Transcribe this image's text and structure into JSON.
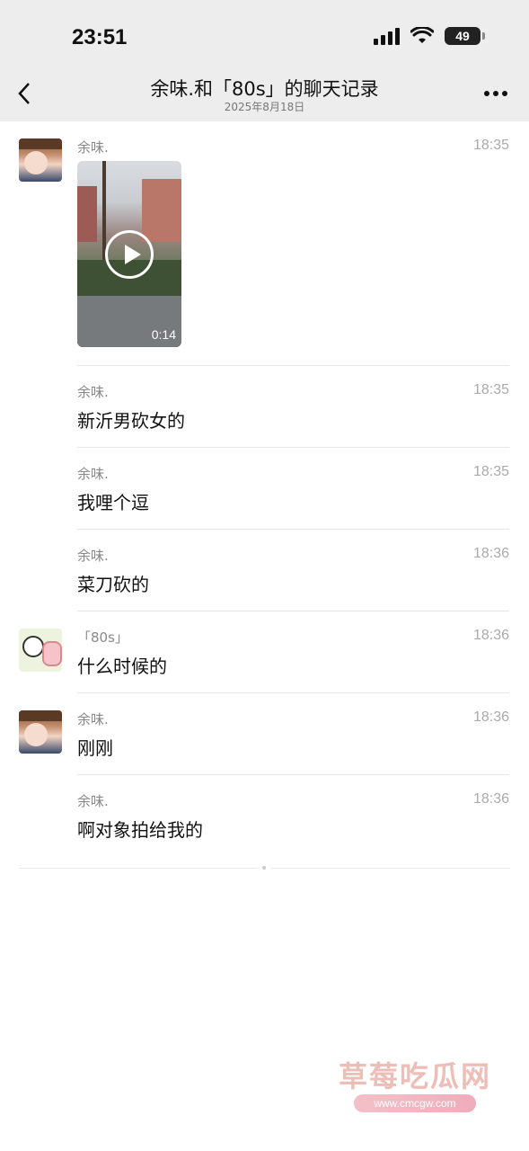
{
  "status_bar": {
    "time": "23:51",
    "battery": "49"
  },
  "nav": {
    "back_icon": "chevron-left-icon",
    "title": "余味.和「80s」的聊天记录",
    "subtitle": "2025年8月18日",
    "more_icon": "more-dots-icon"
  },
  "messages": [
    {
      "sender": "余味.",
      "time": "18:35",
      "type": "video",
      "duration": "0:14"
    },
    {
      "sender": "余味.",
      "time": "18:35",
      "text": "新沂男砍女的"
    },
    {
      "sender": "余味.",
      "time": "18:35",
      "text": "我哩个逗"
    },
    {
      "sender": "余味.",
      "time": "18:36",
      "text": "菜刀砍的"
    },
    {
      "sender": "「80s」",
      "time": "18:36",
      "text": "什么时候的"
    },
    {
      "sender": "余味.",
      "time": "18:36",
      "text": "刚刚"
    },
    {
      "sender": "余味.",
      "time": "18:36",
      "text": "啊对象拍给我的"
    }
  ],
  "watermark": {
    "text": "草莓吃瓜网",
    "url": "www.cmcgw.com"
  }
}
